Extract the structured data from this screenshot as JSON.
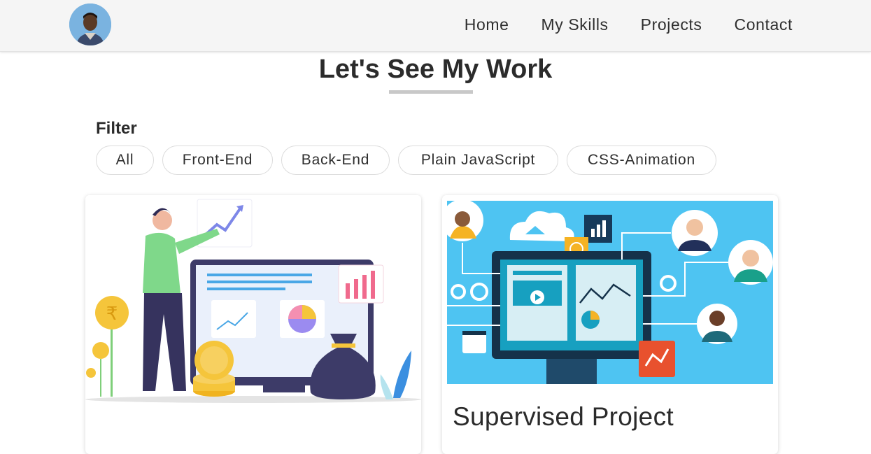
{
  "nav": {
    "avatar_alt": "",
    "links": [
      {
        "label": "Home"
      },
      {
        "label": "My Skills"
      },
      {
        "label": "Projects"
      },
      {
        "label": "Contact"
      }
    ]
  },
  "section": {
    "title": "Let's See My Work"
  },
  "filter": {
    "label": "Filter",
    "options": [
      {
        "label": "All"
      },
      {
        "label": "Front-End"
      },
      {
        "label": "Back-End"
      },
      {
        "label": "Plain JavaScript"
      },
      {
        "label": "CSS-Animation"
      }
    ]
  },
  "projects": [
    {
      "title": "",
      "image_icon": "finance-dashboard-illustration",
      "currency_symbol": "₹"
    },
    {
      "title": "Supervised Project",
      "image_icon": "monitor-network-illustration"
    }
  ],
  "colors": {
    "nav_bg": "#f5f5f5",
    "text": "#2b2b2b",
    "underline": "#c8c8c8",
    "illustration_sky": "#4ec4f2"
  }
}
